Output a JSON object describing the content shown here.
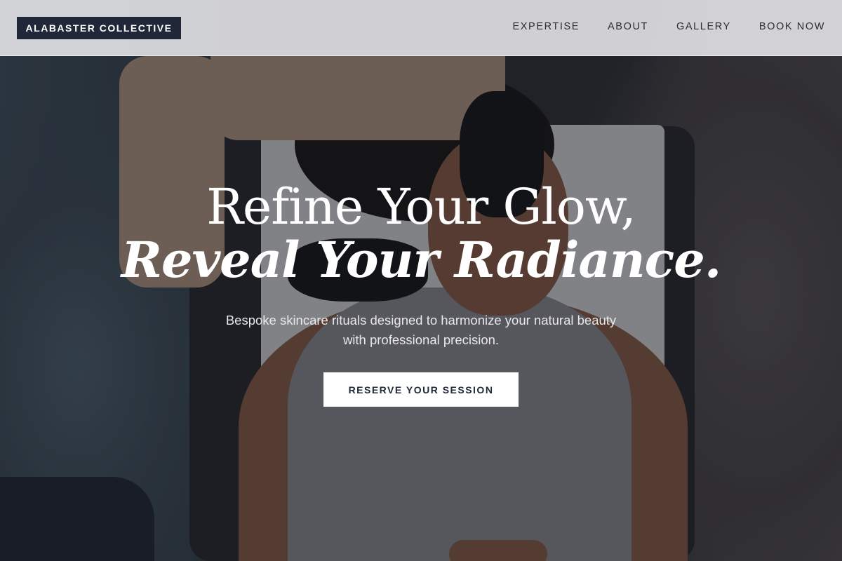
{
  "brand": {
    "name": "ALABASTER COLLECTIVE"
  },
  "nav": {
    "items": [
      {
        "label": "EXPERTISE"
      },
      {
        "label": "ABOUT"
      },
      {
        "label": "GALLERY"
      },
      {
        "label": "BOOK NOW"
      }
    ]
  },
  "hero": {
    "headline_line1": "Refine Your Glow,",
    "headline_line2": "Reveal Your Radiance.",
    "subtext_line1": "Bespoke skincare rituals designed to harmonize your natural beauty",
    "subtext_line2": "with professional precision.",
    "cta_label": "RESERVE YOUR SESSION"
  },
  "colors": {
    "brand_navy": "#1f2739",
    "header_bg": "#e8e8ea",
    "cta_bg": "#ffffff"
  }
}
